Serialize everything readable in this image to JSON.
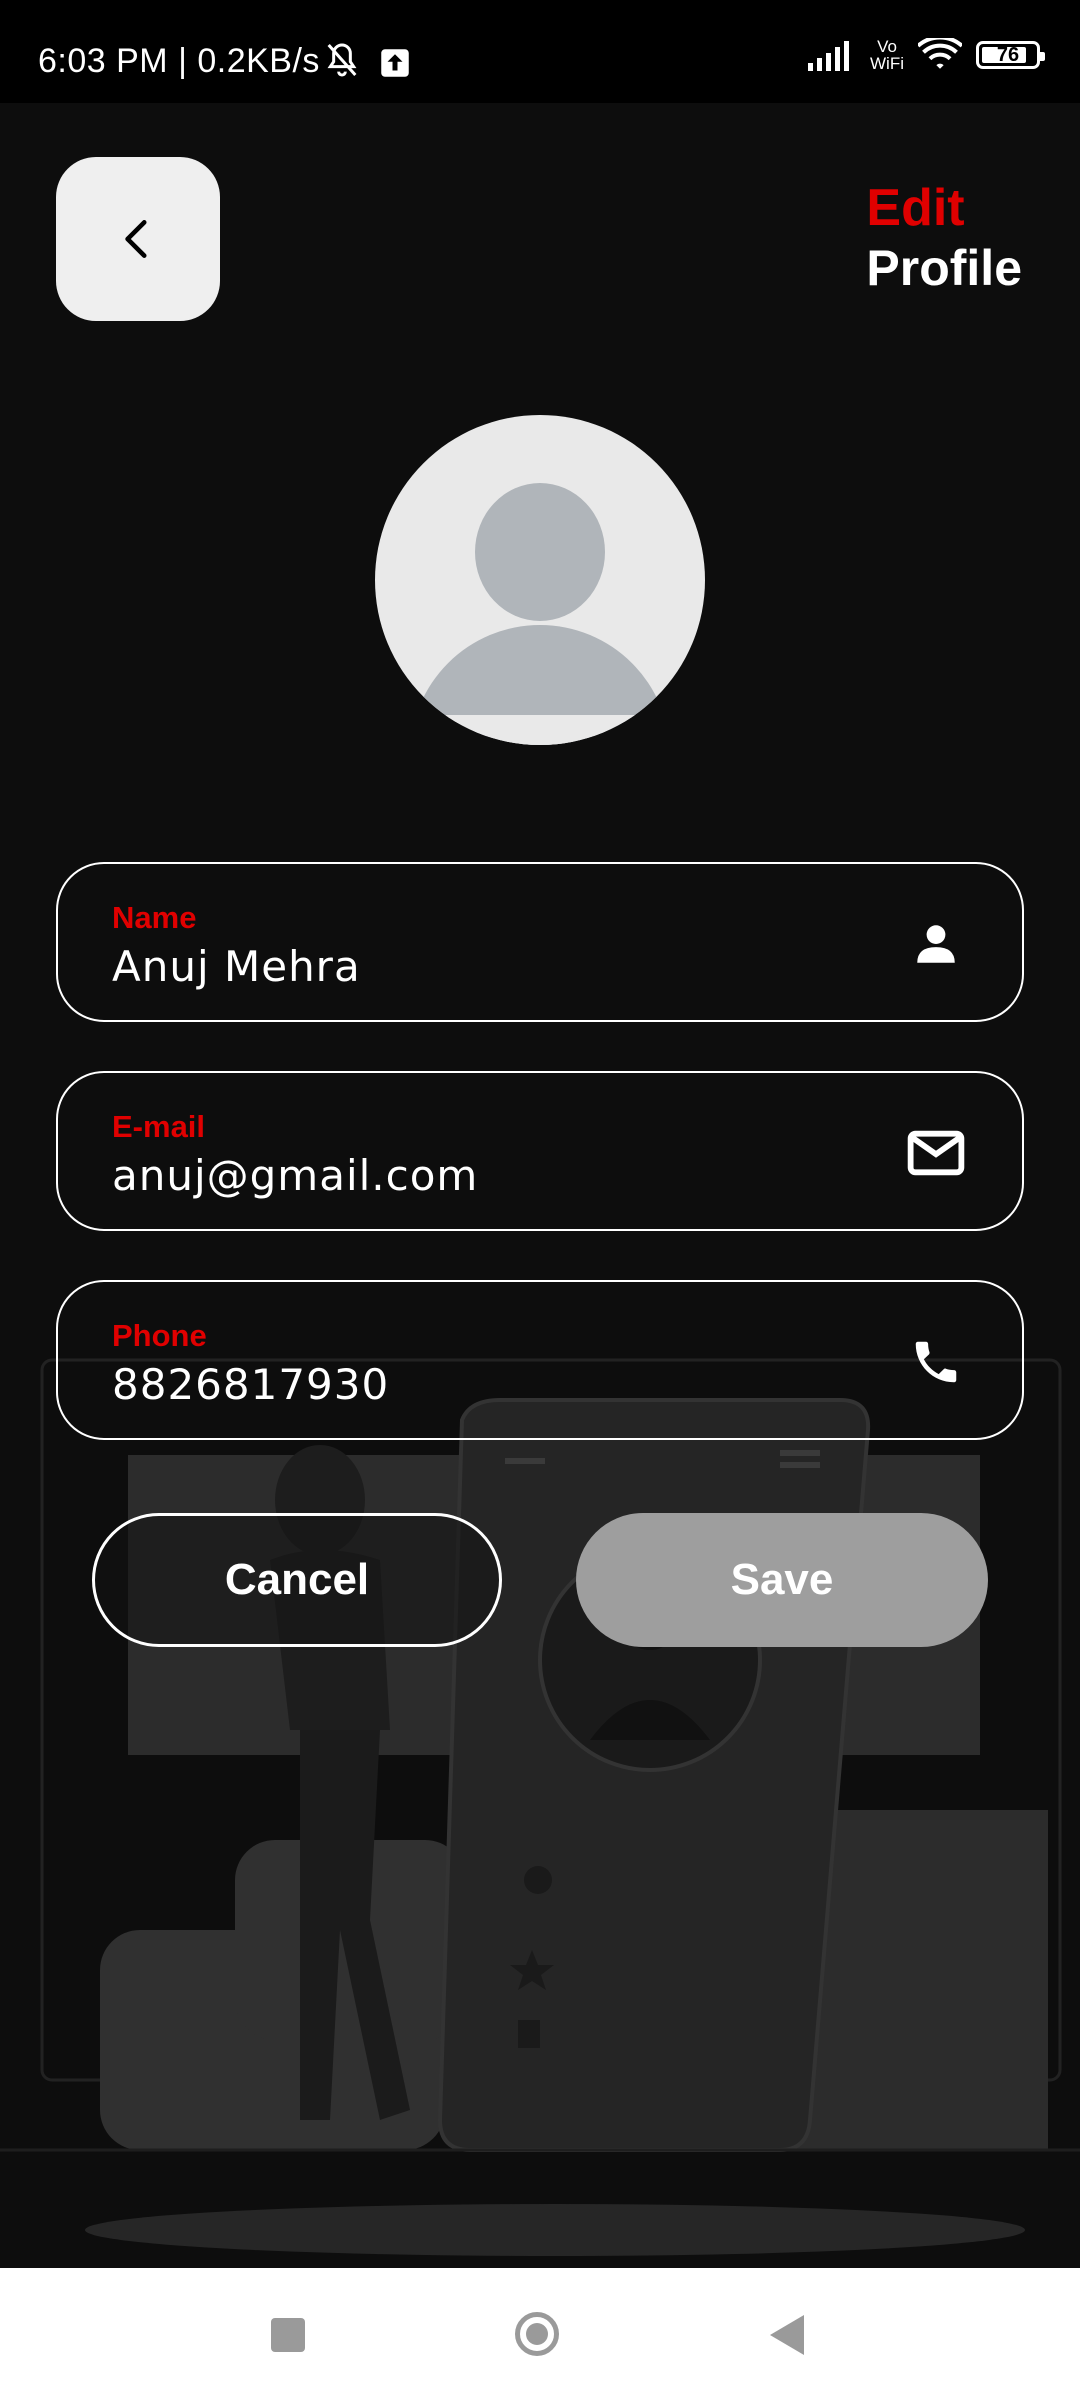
{
  "status_bar": {
    "time_text": "6:03 PM | 0.2KB/s",
    "vowifi_top": "Vo",
    "vowifi_bottom": "WiFi",
    "battery": "76"
  },
  "header": {
    "title_line1": "Edit",
    "title_line2": "Profile"
  },
  "form": {
    "name": {
      "label": "Name",
      "value": "Anuj Mehra",
      "icon": "person-icon"
    },
    "email": {
      "label": "E-mail",
      "value": "anuj@gmail.com",
      "icon": "mail-icon"
    },
    "phone": {
      "label": "Phone",
      "value": "8826817930",
      "icon": "phone-icon"
    }
  },
  "actions": {
    "cancel_label": "Cancel",
    "save_label": "Save"
  },
  "colors": {
    "accent": "#e00000",
    "background": "#0d0d0d",
    "save_button": "#9e9e9e"
  }
}
